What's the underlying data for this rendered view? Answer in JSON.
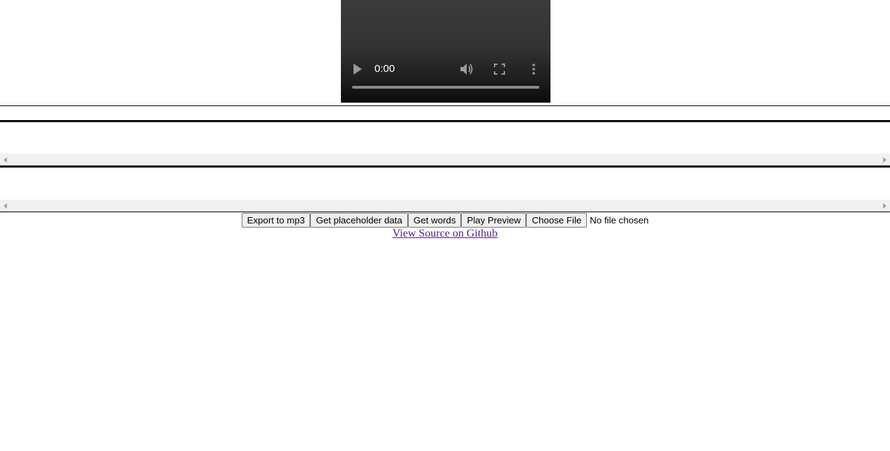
{
  "video": {
    "time": "0:00",
    "progress": 0,
    "controls": [
      "play-icon",
      "volume-icon",
      "fullscreen-icon",
      "more-vert-icon"
    ]
  },
  "colors": {
    "link_visited": "#551a8b",
    "video_bg": "#333333",
    "scrollbar_track": "#f1f1f1",
    "button_bg": "#efefef"
  },
  "toolbar": {
    "export_label": "Export to mp3",
    "placeholder_label": "Get placeholder data",
    "words_label": "Get words",
    "preview_label": "Play Preview",
    "choose_file_label": "Choose File",
    "file_status": "No file chosen"
  },
  "footer": {
    "source_link": "View Source on Github"
  }
}
